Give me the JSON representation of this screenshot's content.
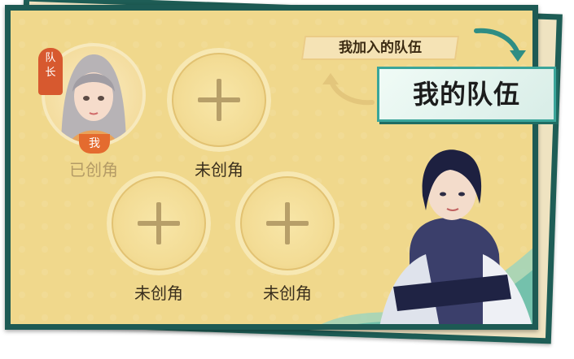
{
  "team_tabs": {
    "joined_label": "我加入的队伍",
    "my_team_label": "我的队伍"
  },
  "leader": {
    "tag": "队长",
    "self_badge": "我",
    "status": "已创角"
  },
  "slots": [
    {
      "status": "未创角"
    },
    {
      "status": "未创角"
    },
    {
      "status": "未创角"
    }
  ],
  "colors": {
    "frame": "#1d5a54",
    "panel_bg": "#f0d88c",
    "accent_teal": "#3aa59a",
    "leader_badge": "#d7592f"
  }
}
